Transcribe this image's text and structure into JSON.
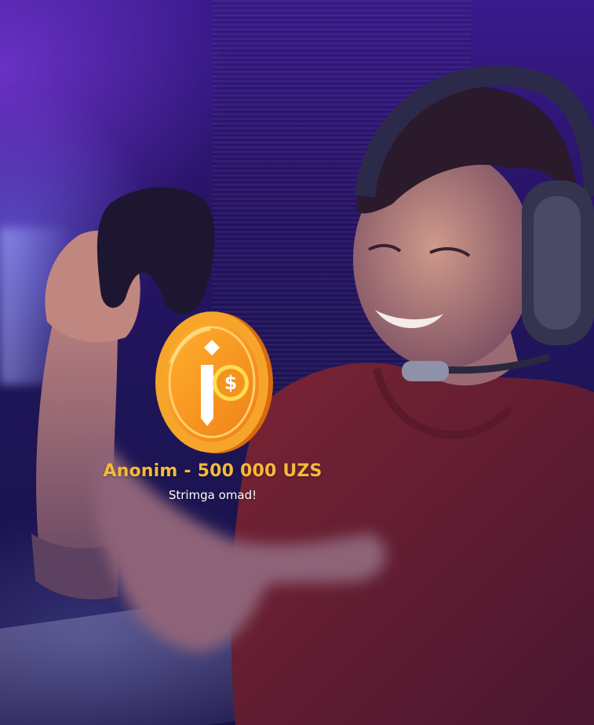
{
  "alert": {
    "donor_line": "Anonim - 500 000 UZS",
    "message": "Strimga omad!"
  },
  "coin": {
    "icon": "dollar-coin-logo",
    "colors": {
      "rim": "#f08a1c",
      "face": "#f7a627",
      "highlight": "#ffd85c",
      "symbol": "#ffffff"
    }
  },
  "background": {
    "scene": "gamer-with-headset-and-controller",
    "colors": {
      "top": "#3a1a8c",
      "bottom": "#171244",
      "shirt": "#6b2030",
      "skin": "#c98a78"
    }
  },
  "text_colors": {
    "donor": "#f5b93c",
    "message": "#ffffff"
  }
}
